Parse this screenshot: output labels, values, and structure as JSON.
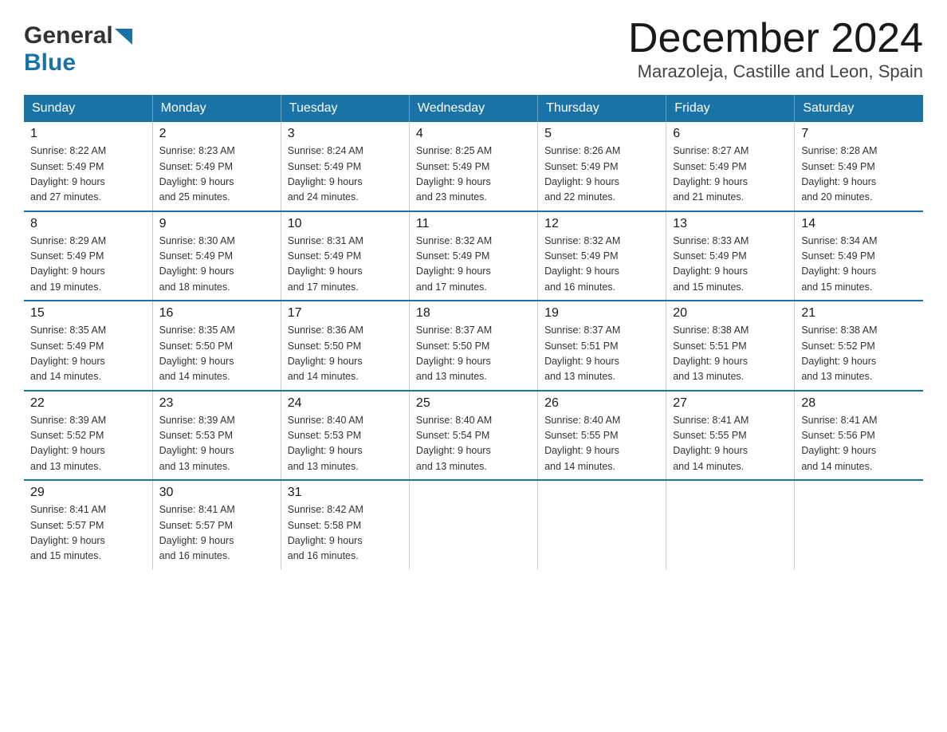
{
  "header": {
    "logo_general": "General",
    "logo_blue": "Blue",
    "month_title": "December 2024",
    "location": "Marazoleja, Castille and Leon, Spain"
  },
  "weekdays": [
    "Sunday",
    "Monday",
    "Tuesday",
    "Wednesday",
    "Thursday",
    "Friday",
    "Saturday"
  ],
  "weeks": [
    [
      {
        "day": "1",
        "sunrise": "8:22 AM",
        "sunset": "5:49 PM",
        "daylight": "9 hours and 27 minutes."
      },
      {
        "day": "2",
        "sunrise": "8:23 AM",
        "sunset": "5:49 PM",
        "daylight": "9 hours and 25 minutes."
      },
      {
        "day": "3",
        "sunrise": "8:24 AM",
        "sunset": "5:49 PM",
        "daylight": "9 hours and 24 minutes."
      },
      {
        "day": "4",
        "sunrise": "8:25 AM",
        "sunset": "5:49 PM",
        "daylight": "9 hours and 23 minutes."
      },
      {
        "day": "5",
        "sunrise": "8:26 AM",
        "sunset": "5:49 PM",
        "daylight": "9 hours and 22 minutes."
      },
      {
        "day": "6",
        "sunrise": "8:27 AM",
        "sunset": "5:49 PM",
        "daylight": "9 hours and 21 minutes."
      },
      {
        "day": "7",
        "sunrise": "8:28 AM",
        "sunset": "5:49 PM",
        "daylight": "9 hours and 20 minutes."
      }
    ],
    [
      {
        "day": "8",
        "sunrise": "8:29 AM",
        "sunset": "5:49 PM",
        "daylight": "9 hours and 19 minutes."
      },
      {
        "day": "9",
        "sunrise": "8:30 AM",
        "sunset": "5:49 PM",
        "daylight": "9 hours and 18 minutes."
      },
      {
        "day": "10",
        "sunrise": "8:31 AM",
        "sunset": "5:49 PM",
        "daylight": "9 hours and 17 minutes."
      },
      {
        "day": "11",
        "sunrise": "8:32 AM",
        "sunset": "5:49 PM",
        "daylight": "9 hours and 17 minutes."
      },
      {
        "day": "12",
        "sunrise": "8:32 AM",
        "sunset": "5:49 PM",
        "daylight": "9 hours and 16 minutes."
      },
      {
        "day": "13",
        "sunrise": "8:33 AM",
        "sunset": "5:49 PM",
        "daylight": "9 hours and 15 minutes."
      },
      {
        "day": "14",
        "sunrise": "8:34 AM",
        "sunset": "5:49 PM",
        "daylight": "9 hours and 15 minutes."
      }
    ],
    [
      {
        "day": "15",
        "sunrise": "8:35 AM",
        "sunset": "5:49 PM",
        "daylight": "9 hours and 14 minutes."
      },
      {
        "day": "16",
        "sunrise": "8:35 AM",
        "sunset": "5:50 PM",
        "daylight": "9 hours and 14 minutes."
      },
      {
        "day": "17",
        "sunrise": "8:36 AM",
        "sunset": "5:50 PM",
        "daylight": "9 hours and 14 minutes."
      },
      {
        "day": "18",
        "sunrise": "8:37 AM",
        "sunset": "5:50 PM",
        "daylight": "9 hours and 13 minutes."
      },
      {
        "day": "19",
        "sunrise": "8:37 AM",
        "sunset": "5:51 PM",
        "daylight": "9 hours and 13 minutes."
      },
      {
        "day": "20",
        "sunrise": "8:38 AM",
        "sunset": "5:51 PM",
        "daylight": "9 hours and 13 minutes."
      },
      {
        "day": "21",
        "sunrise": "8:38 AM",
        "sunset": "5:52 PM",
        "daylight": "9 hours and 13 minutes."
      }
    ],
    [
      {
        "day": "22",
        "sunrise": "8:39 AM",
        "sunset": "5:52 PM",
        "daylight": "9 hours and 13 minutes."
      },
      {
        "day": "23",
        "sunrise": "8:39 AM",
        "sunset": "5:53 PM",
        "daylight": "9 hours and 13 minutes."
      },
      {
        "day": "24",
        "sunrise": "8:40 AM",
        "sunset": "5:53 PM",
        "daylight": "9 hours and 13 minutes."
      },
      {
        "day": "25",
        "sunrise": "8:40 AM",
        "sunset": "5:54 PM",
        "daylight": "9 hours and 13 minutes."
      },
      {
        "day": "26",
        "sunrise": "8:40 AM",
        "sunset": "5:55 PM",
        "daylight": "9 hours and 14 minutes."
      },
      {
        "day": "27",
        "sunrise": "8:41 AM",
        "sunset": "5:55 PM",
        "daylight": "9 hours and 14 minutes."
      },
      {
        "day": "28",
        "sunrise": "8:41 AM",
        "sunset": "5:56 PM",
        "daylight": "9 hours and 14 minutes."
      }
    ],
    [
      {
        "day": "29",
        "sunrise": "8:41 AM",
        "sunset": "5:57 PM",
        "daylight": "9 hours and 15 minutes."
      },
      {
        "day": "30",
        "sunrise": "8:41 AM",
        "sunset": "5:57 PM",
        "daylight": "9 hours and 16 minutes."
      },
      {
        "day": "31",
        "sunrise": "8:42 AM",
        "sunset": "5:58 PM",
        "daylight": "9 hours and 16 minutes."
      },
      null,
      null,
      null,
      null
    ]
  ],
  "labels": {
    "sunrise": "Sunrise:",
    "sunset": "Sunset:",
    "daylight": "Daylight:"
  }
}
